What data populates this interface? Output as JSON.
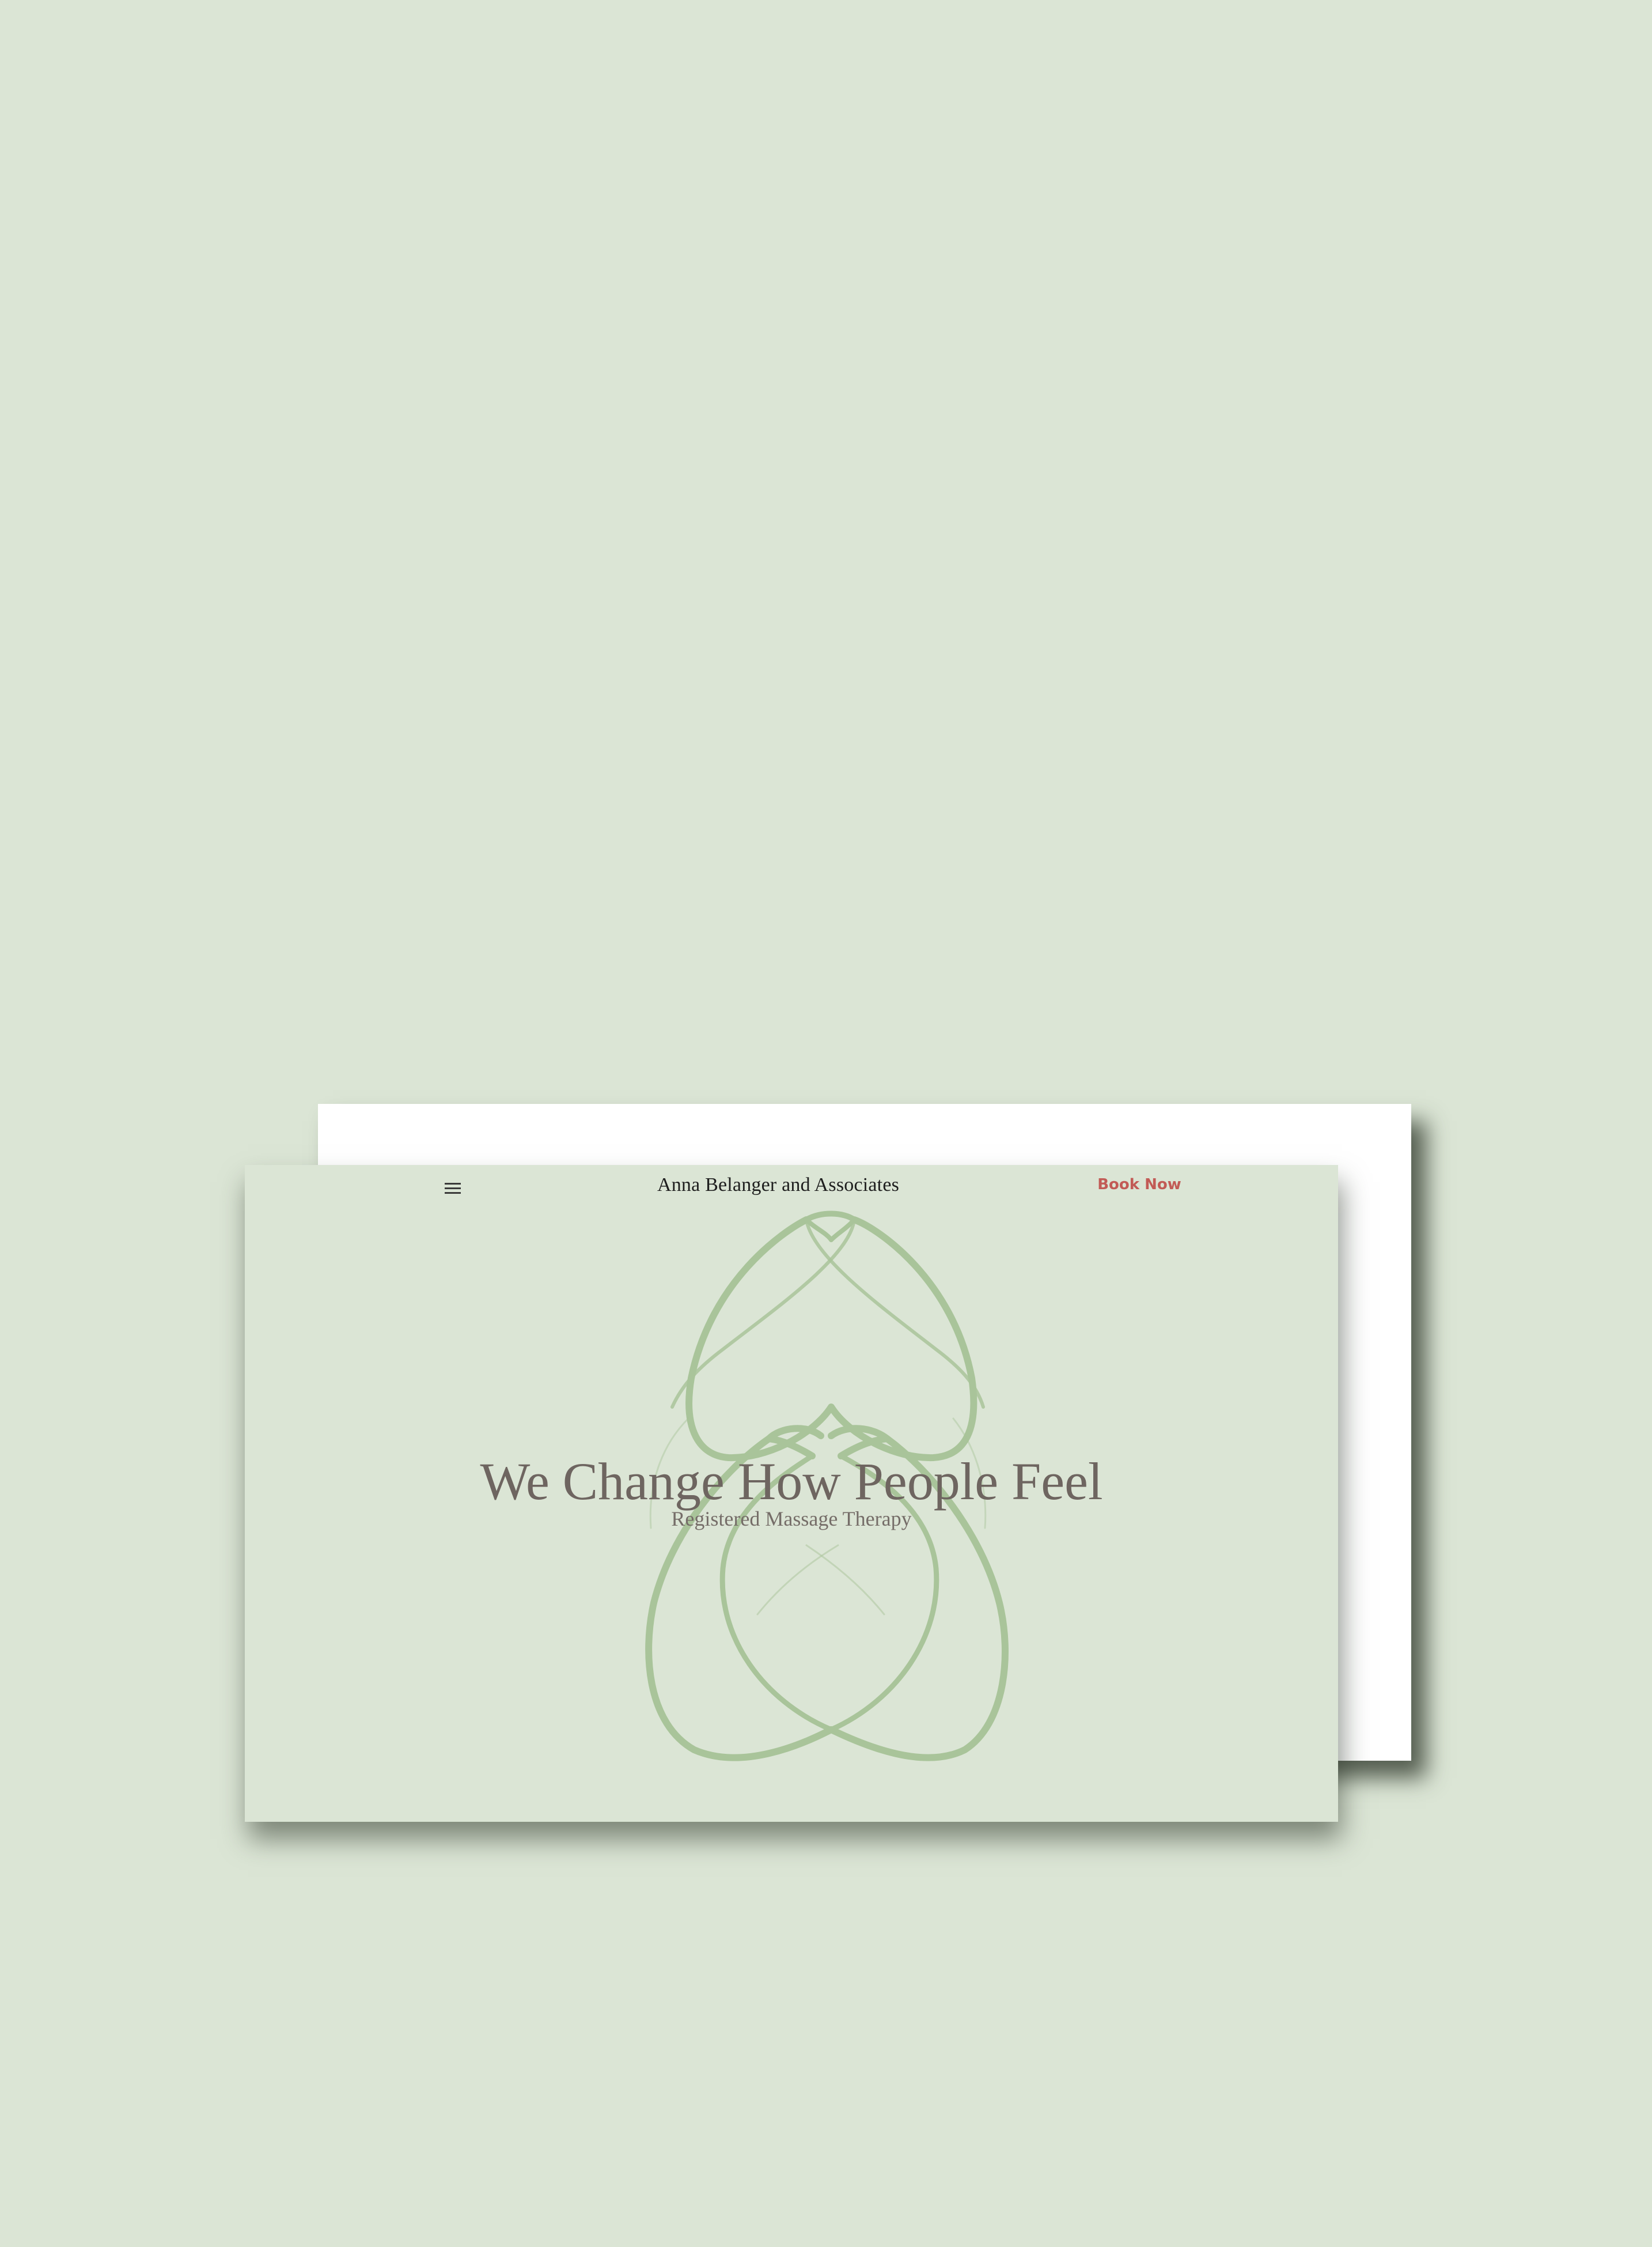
{
  "header": {
    "menu_icon": "hamburger-menu-icon",
    "site_title": "Anna Belanger and Associates",
    "book_now_label": "Book Now"
  },
  "hero": {
    "title": "We Change How People Feel",
    "subtitle": "Registered Massage Therapy",
    "logo_icon": "intertwined-hearts-logo"
  },
  "colors": {
    "background": "#dbe5d5",
    "accent": "#c25b56",
    "logo_stroke": "#a9c49a",
    "heading_text": "#6e6560"
  }
}
